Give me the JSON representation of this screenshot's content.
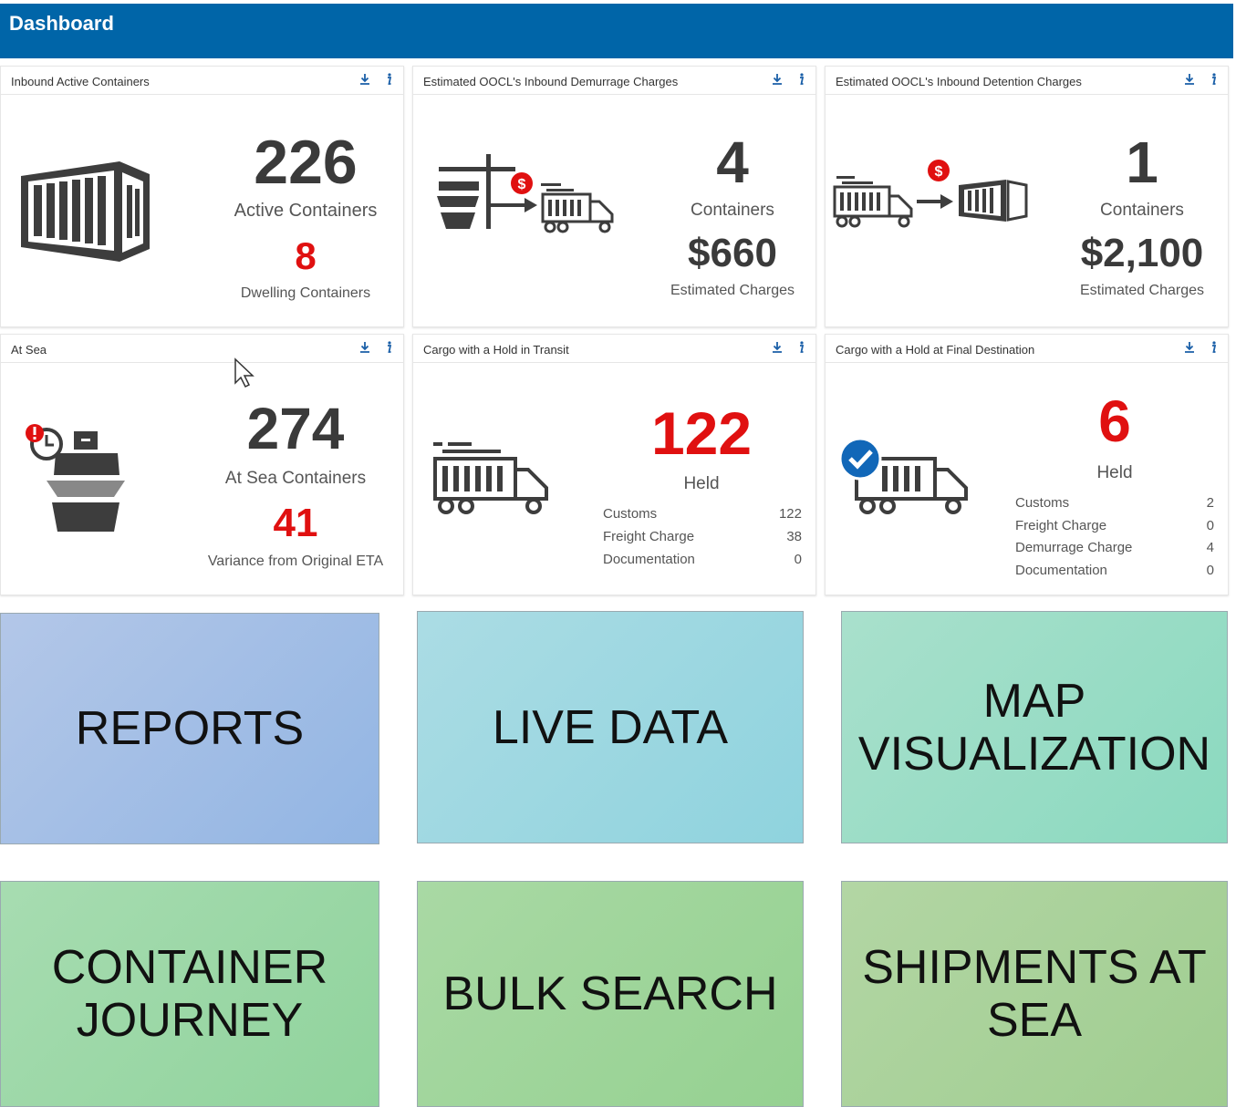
{
  "header": {
    "title": "Dashboard"
  },
  "panels": {
    "inbound_active": {
      "title": "Inbound Active Containers",
      "count": "226",
      "count_label": "Active Containers",
      "secondary": "8",
      "secondary_label": "Dwelling Containers"
    },
    "demurrage": {
      "title": "Estimated OOCL's Inbound Demurrage Charges",
      "count": "4",
      "count_label": "Containers",
      "amount": "$660",
      "amount_label": "Estimated Charges"
    },
    "detention": {
      "title": "Estimated OOCL's Inbound Detention Charges",
      "count": "1",
      "count_label": "Containers",
      "amount": "$2,100",
      "amount_label": "Estimated Charges"
    },
    "at_sea": {
      "title": "At Sea",
      "count": "274",
      "count_label": "At Sea Containers",
      "secondary": "41",
      "secondary_label": "Variance from Original ETA"
    },
    "hold_transit": {
      "title": "Cargo with a Hold in Transit",
      "count": "122",
      "count_label": "Held",
      "rows": [
        {
          "label": "Customs",
          "value": "122"
        },
        {
          "label": "Freight Charge",
          "value": "38"
        },
        {
          "label": "Documentation",
          "value": "0"
        }
      ]
    },
    "hold_final": {
      "title": "Cargo with a Hold at Final Destination",
      "count": "6",
      "count_label": "Held",
      "rows": [
        {
          "label": "Customs",
          "value": "2"
        },
        {
          "label": "Freight Charge",
          "value": "0"
        },
        {
          "label": "Demurrage Charge",
          "value": "4"
        },
        {
          "label": "Documentation",
          "value": "0"
        }
      ]
    }
  },
  "tiles": {
    "reports": [
      "REPORTS"
    ],
    "live_data": [
      "LIVE DATA"
    ],
    "map_visualization": [
      "MAP",
      "VISUALIZATION"
    ],
    "container_journey": [
      "CONTAINER",
      "JOURNEY"
    ],
    "bulk_search": [
      "BULK SEARCH"
    ],
    "shipments_at_sea": [
      "SHIPMENTS AT",
      "SEA"
    ]
  },
  "icons": {
    "download": "download-icon",
    "info": "info-icon",
    "container": "shipping-container-icon",
    "ship": "cargo-ship-icon",
    "truck": "truck-icon",
    "dollar": "dollar-badge-icon",
    "alert": "alert-badge-icon",
    "clock": "clock-icon",
    "check": "checkmark-badge-icon"
  },
  "colors": {
    "header": "#0065a8",
    "accent_red": "#e01010",
    "icon_dark": "#3d3d3d",
    "check_blue": "#1167b8"
  }
}
